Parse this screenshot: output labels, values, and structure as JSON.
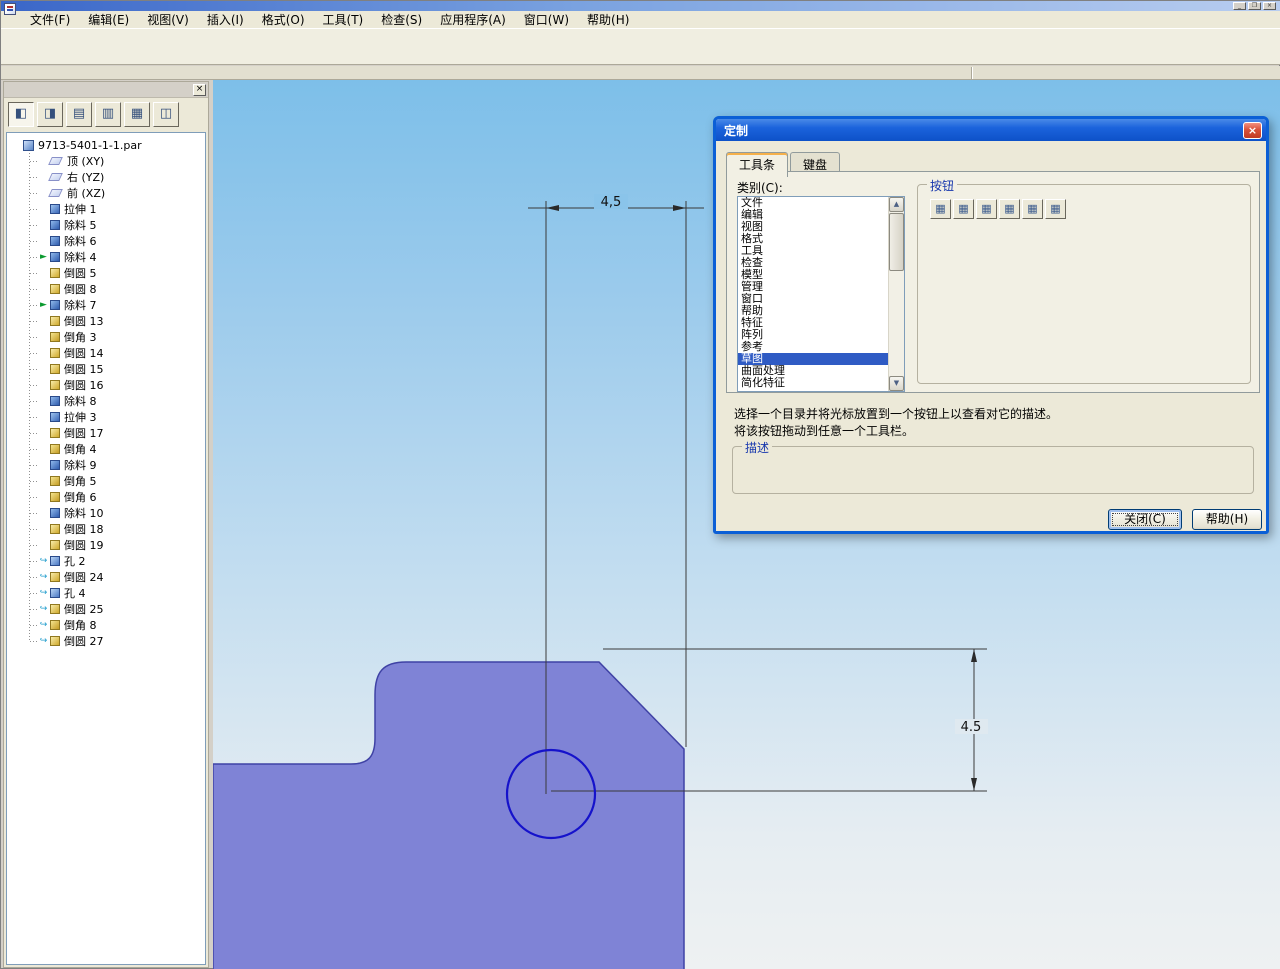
{
  "window": {
    "controls": {
      "minimize": "_",
      "maximize": "❐",
      "close": "×"
    }
  },
  "menubar": {
    "items": [
      "文件(F)",
      "编辑(E)",
      "视图(V)",
      "插入(I)",
      "格式(O)",
      "工具(T)",
      "检查(S)",
      "应用程序(A)",
      "窗口(W)",
      "帮助(H)"
    ]
  },
  "edgebar": {
    "close_glyph": "×",
    "tools": [
      {
        "name": "feature-pathfinder-icon",
        "glyph": "◧"
      },
      {
        "name": "library-icon",
        "glyph": "◨"
      },
      {
        "name": "family-table-icon",
        "glyph": "▤"
      },
      {
        "name": "layers-icon",
        "glyph": "▥"
      },
      {
        "name": "sensors-icon",
        "glyph": "▦"
      },
      {
        "name": "selection-tools-icon",
        "glyph": "◫"
      }
    ],
    "tree": {
      "root": "9713-5401-1-1.par",
      "items": [
        {
          "label": "顶 (XY)",
          "type": "plane",
          "prefix": ""
        },
        {
          "label": "右 (YZ)",
          "type": "plane",
          "prefix": ""
        },
        {
          "label": "前 (XZ)",
          "type": "plane",
          "prefix": ""
        },
        {
          "label": "拉伸 1",
          "type": "extrude",
          "prefix": ""
        },
        {
          "label": "除料 5",
          "type": "cut",
          "prefix": ""
        },
        {
          "label": "除料 6",
          "type": "cut",
          "prefix": ""
        },
        {
          "label": "除料 4",
          "type": "cut",
          "prefix": "arrow"
        },
        {
          "label": "倒圆 5",
          "type": "round",
          "prefix": ""
        },
        {
          "label": "倒圆 8",
          "type": "round",
          "prefix": ""
        },
        {
          "label": "除料 7",
          "type": "cut",
          "prefix": "arrow"
        },
        {
          "label": "倒圆 13",
          "type": "round",
          "prefix": ""
        },
        {
          "label": "倒角 3",
          "type": "chamfer",
          "prefix": ""
        },
        {
          "label": "倒圆 14",
          "type": "round",
          "prefix": ""
        },
        {
          "label": "倒圆 15",
          "type": "round",
          "prefix": ""
        },
        {
          "label": "倒圆 16",
          "type": "round",
          "prefix": ""
        },
        {
          "label": "除料 8",
          "type": "cut",
          "prefix": ""
        },
        {
          "label": "拉伸 3",
          "type": "extrude",
          "prefix": ""
        },
        {
          "label": "倒圆 17",
          "type": "round",
          "prefix": ""
        },
        {
          "label": "倒角 4",
          "type": "chamfer",
          "prefix": ""
        },
        {
          "label": "除料 9",
          "type": "cut",
          "prefix": ""
        },
        {
          "label": "倒角 5",
          "type": "chamfer",
          "prefix": ""
        },
        {
          "label": "倒角 6",
          "type": "chamfer",
          "prefix": ""
        },
        {
          "label": "除料 10",
          "type": "cut",
          "prefix": ""
        },
        {
          "label": "倒圆 18",
          "type": "round",
          "prefix": ""
        },
        {
          "label": "倒圆 19",
          "type": "round",
          "prefix": ""
        },
        {
          "label": "孔 2",
          "type": "hole",
          "prefix": "link"
        },
        {
          "label": "倒圆 24",
          "type": "round",
          "prefix": "link"
        },
        {
          "label": "孔 4",
          "type": "hole",
          "prefix": "link"
        },
        {
          "label": "倒圆 25",
          "type": "round",
          "prefix": "link"
        },
        {
          "label": "倒角 8",
          "type": "chamfer",
          "prefix": "link"
        },
        {
          "label": "倒圆 27",
          "type": "round",
          "prefix": "link"
        }
      ]
    }
  },
  "canvas": {
    "dim_top_label": "4,5",
    "dim_right_label": "4.5",
    "part_fill": "#7f83d6",
    "part_edge": "#3f42a5",
    "circle_color": "#1512cb"
  },
  "dialog": {
    "title": "定制",
    "close_glyph": "×",
    "tabs": [
      "工具条",
      "键盘"
    ],
    "category_label": "类别(C):",
    "categories": [
      "文件",
      "编辑",
      "视图",
      "格式",
      "工具",
      "检查",
      "模型",
      "管理",
      "窗口",
      "帮助",
      "特征",
      "阵列",
      "参考",
      "草图",
      "曲面处理",
      "简化特征"
    ],
    "selected_category": "草图",
    "buttons_group_label": "按钮",
    "toolbar_buttons": [
      "▦",
      "▦",
      "▦",
      "▦",
      "▦",
      "▦"
    ],
    "instructions": [
      "选择一个目录并将光标放置到一个按钮上以查看对它的描述。",
      "将该按钮拖动到任意一个工具栏。"
    ],
    "description_label": "描述",
    "close_button": "关闭(C)",
    "help_button": "帮助(H)",
    "scroll_up_glyph": "▲",
    "scroll_down_glyph": "▼"
  }
}
